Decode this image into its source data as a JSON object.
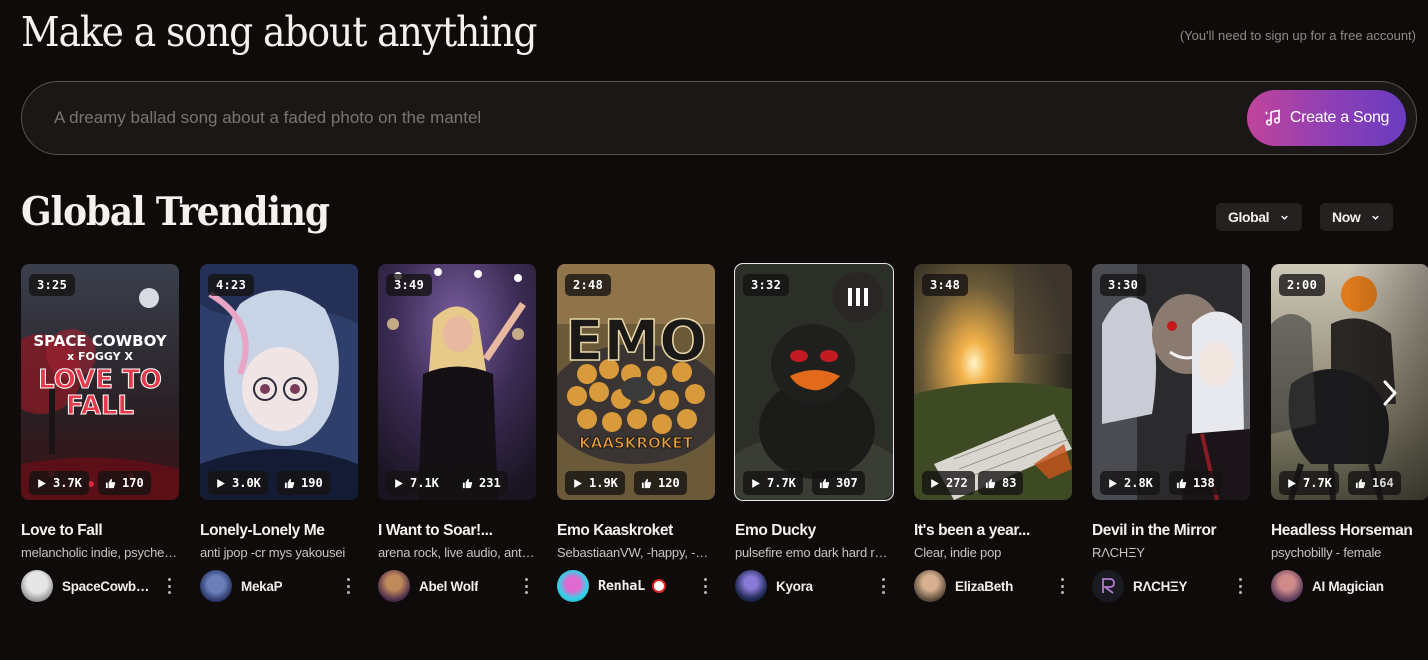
{
  "hero": {
    "title": "Make a song about anything",
    "signup_note": "(You'll need to sign up for a free account)"
  },
  "prompt": {
    "placeholder": "A dreamy ballad song about a faded photo on the mantel",
    "create_label": "Create a Song"
  },
  "trending": {
    "title": "Global Trending",
    "filters": [
      {
        "label": "Global"
      },
      {
        "label": "Now"
      }
    ]
  },
  "cards": [
    {
      "duration": "3:25",
      "plays": "3.7K",
      "likes": "170",
      "title": "Love to Fall",
      "style": "melancholic indie, psychedelic",
      "user": "SpaceCowboy",
      "art_text": [
        "SPACE COWBOY",
        "x FOGGY X",
        "LOVE TO",
        "FALL"
      ]
    },
    {
      "duration": "4:23",
      "plays": "3.0K",
      "likes": "190",
      "title": "Lonely-Lonely Me",
      "style": "anti jpop -cr mys yakousei",
      "user": "MekaP"
    },
    {
      "duration": "3:49",
      "plays": "7.1K",
      "likes": "231",
      "title": "I Want to Soar!...",
      "style": "arena rock, live audio, anthem",
      "user": "Abel Wolf"
    },
    {
      "duration": "2:48",
      "plays": "1.9K",
      "likes": "120",
      "title": "Emo Kaaskroket",
      "style": "SebastiaanVW, -happy, -pop",
      "user": "RenhaL",
      "art_text": [
        "EMO",
        "KAASKROKET"
      ]
    },
    {
      "duration": "3:32",
      "plays": "7.7K",
      "likes": "307",
      "title": "Emo Ducky",
      "style": "pulsefire emo dark hard rock",
      "user": "Kyora"
    },
    {
      "duration": "3:48",
      "plays": "272",
      "likes": "83",
      "title": "It's been a year...",
      "style": "Clear, indie pop",
      "user": "ElizaBeth"
    },
    {
      "duration": "3:30",
      "plays": "2.8K",
      "likes": "138",
      "title": "Devil in the Mirror",
      "style": "RΛCHΞY",
      "user": "RΛCHΞY"
    },
    {
      "duration": "2:00",
      "plays": "7.7K",
      "likes": "164",
      "title": "Headless Horseman",
      "style": "psychobilly - female",
      "user": "AI Magician"
    }
  ],
  "colors": {
    "background": "#0f0b0b",
    "create_gradient_start": "#c0449a",
    "create_gradient_end": "#6a3bc0"
  },
  "icons": {
    "create": "music-note-sparkle-icon",
    "play": "play-icon",
    "like": "thumbs-up-icon",
    "pause": "pause-icon",
    "next": "chevron-right-icon",
    "more": "more-vertical-icon"
  }
}
